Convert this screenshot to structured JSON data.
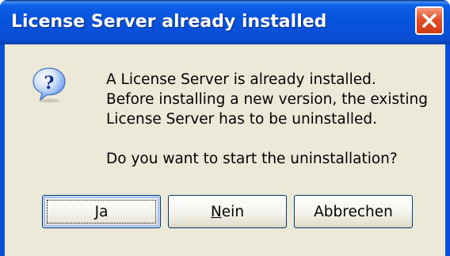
{
  "window": {
    "title": "License Server already installed"
  },
  "icons": {
    "title_close": "close-icon",
    "message": "question-icon"
  },
  "message": {
    "lines": [
      "A License Server is already installed.",
      "Before installing a new version, the existing",
      "License Server has to be uninstalled."
    ],
    "question": "Do you want to start the uninstallation?"
  },
  "buttons": {
    "yes": {
      "mnemonic": "J",
      "rest": "a"
    },
    "no": {
      "mnemonic": "N",
      "rest": "ein"
    },
    "cancel": {
      "label": "Abbrechen"
    }
  },
  "colors": {
    "titlebar": "#0a4fd8",
    "close_button": "#e2502a",
    "dialog_background": "#ece9d8",
    "icon_blue": "#3a78e0"
  }
}
